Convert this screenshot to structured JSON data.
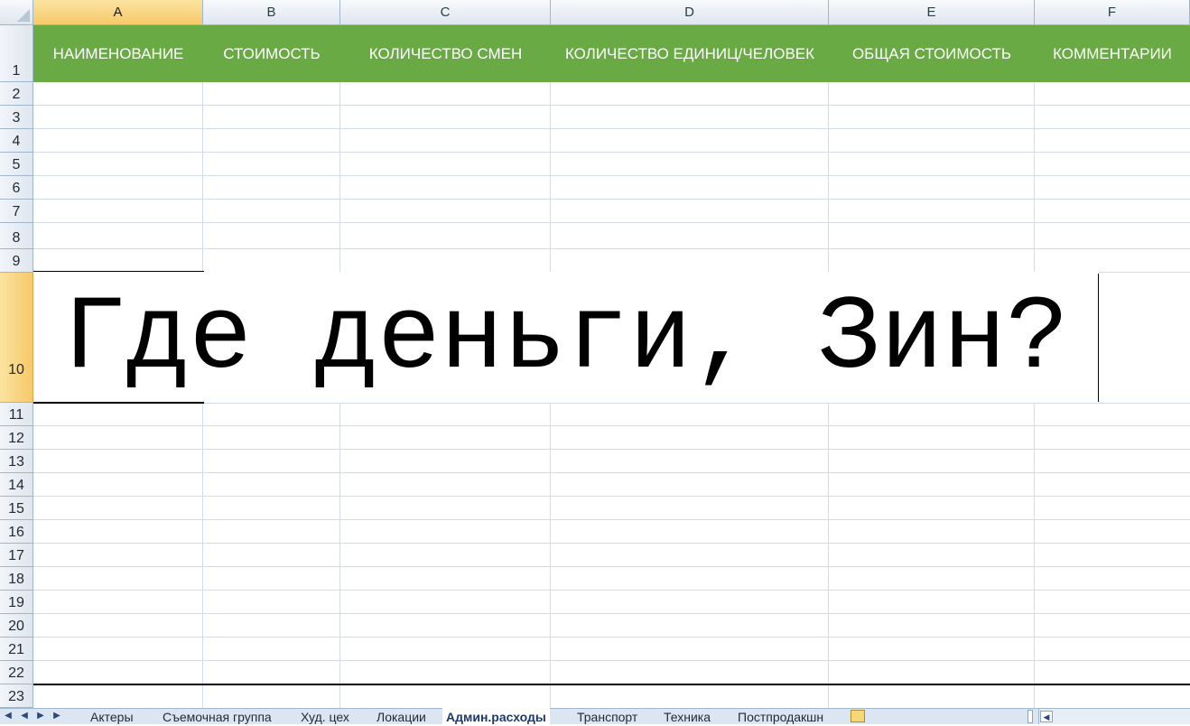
{
  "columns": [
    "A",
    "B",
    "C",
    "D",
    "E",
    "F"
  ],
  "rows": [
    "1",
    "2",
    "3",
    "4",
    "5",
    "6",
    "7",
    "8",
    "9",
    "10",
    "11",
    "12",
    "13",
    "14",
    "15",
    "16",
    "17",
    "18",
    "19",
    "20",
    "21",
    "22",
    "23"
  ],
  "header_row": {
    "a": "НАИМЕНОВАНИЕ",
    "b": "СТОИМОСТЬ",
    "c": "КОЛИЧЕСТВО СМЕН",
    "d": "КОЛИЧЕСТВО ЕДИНИЦ/ЧЕЛОВЕК",
    "e": "ОБЩАЯ СТОИМОСТЬ",
    "f": "КОММЕНТАРИИ"
  },
  "merged_cell": {
    "text": "Где деньги, Зин?"
  },
  "selected_cell": "A10",
  "colors": {
    "header_green": "#6aaa44",
    "selection_orange": "#f7c96a"
  },
  "sheet_tabs": [
    "Актеры",
    "Съемочная группа",
    "Худ. цех",
    "Локации",
    "Админ.расходы",
    "Транспорт",
    "Техника",
    "Постпродакшн"
  ],
  "active_tab": "Админ.расходы"
}
